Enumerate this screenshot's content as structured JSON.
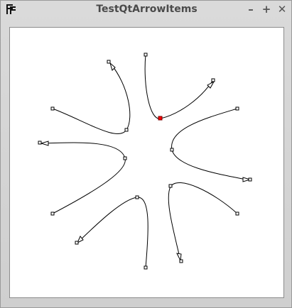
{
  "window": {
    "title": "TestQtArrowItems",
    "controls": {
      "minimize": "–",
      "maximize": "+",
      "close": "✕"
    },
    "icon": "app-logo-icon"
  },
  "scene": {
    "background": "#ffffff",
    "curve_color": "#000000",
    "handle_color": "#000000",
    "selected_handle_color": "#ff0000"
  }
}
